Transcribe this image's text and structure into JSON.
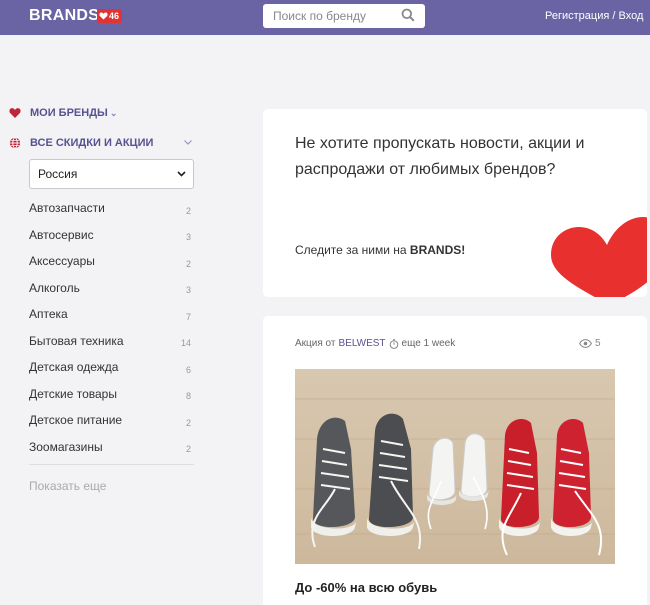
{
  "header": {
    "logo": "BRANDS",
    "badge_count": "46",
    "search_placeholder": "Поиск по бренду",
    "register": "Регистрация",
    "separator": " / ",
    "login": "Вход"
  },
  "sidebar": {
    "my_brands": "МОИ БРЕНДЫ",
    "all_deals": "ВСЕ СКИДКИ И АКЦИИ",
    "region": "Россия",
    "categories": [
      {
        "label": "Автозапчасти",
        "count": "2"
      },
      {
        "label": "Автосервис",
        "count": "3"
      },
      {
        "label": "Аксессуары",
        "count": "2"
      },
      {
        "label": "Алкоголь",
        "count": "3"
      },
      {
        "label": "Аптека",
        "count": "7"
      },
      {
        "label": "Бытовая техника",
        "count": "14"
      },
      {
        "label": "Детская одежда",
        "count": "6"
      },
      {
        "label": "Детские товары",
        "count": "8"
      },
      {
        "label": "Детское питание",
        "count": "2"
      },
      {
        "label": "Зоомагазины",
        "count": "2"
      }
    ],
    "show_more": "Показать еще"
  },
  "promo": {
    "text": "Не хотите пропускать новости, акции и распродажи от любимых брендов?",
    "follow_prefix": "Следите за ними на ",
    "follow_brand": "BRANDS!"
  },
  "deal": {
    "prefix": "Акция от",
    "brand": "BELWEST",
    "time": "еще 1 week",
    "views": "5",
    "title": "До -60% на всю обувь"
  },
  "colors": {
    "header_bg": "#6a64a4",
    "accent": "#56528f",
    "heart": "#e8312f"
  }
}
